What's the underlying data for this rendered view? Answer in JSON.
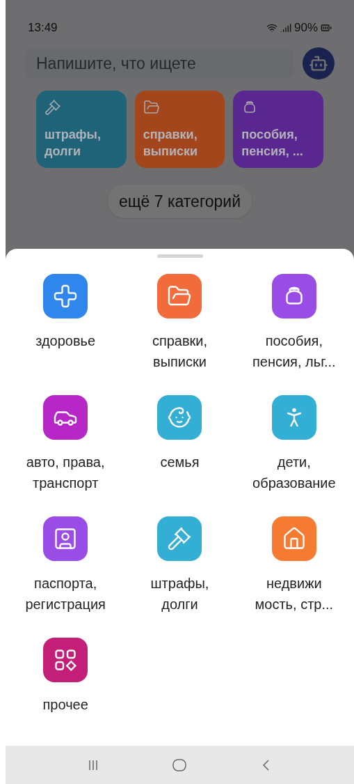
{
  "status_bar": {
    "time": "13:49",
    "battery": "90%"
  },
  "search": {
    "placeholder": "Напишите, что ищете"
  },
  "quick_tiles": [
    {
      "label": "штрафы,\nдолги",
      "kind": "fines",
      "color": "#1f6378"
    },
    {
      "label": "справки,\nвыписки",
      "kind": "documents",
      "color": "#a4461c"
    },
    {
      "label": "пособия,\nпенсия, ...",
      "kind": "benefits",
      "color": "#59278f"
    }
  ],
  "more_button": {
    "label": "ещё 7 категорий"
  },
  "categories": [
    {
      "label": "здоровье",
      "kind": "health",
      "color": "#2f86ec"
    },
    {
      "label": "справки,\nвыписки",
      "kind": "documents",
      "color": "#f26b3a"
    },
    {
      "label": "пособия,\nпенсия, льг...",
      "kind": "benefits",
      "color": "#9a4de6"
    },
    {
      "label": "авто, права,\nтранспорт",
      "kind": "auto",
      "color": "#b726c7"
    },
    {
      "label": "семья",
      "kind": "family",
      "color": "#33aed4"
    },
    {
      "label": "дети,\nобразование",
      "kind": "children",
      "color": "#33aed4"
    },
    {
      "label": "паспорта,\nрегистрация",
      "kind": "passport",
      "color": "#9a4de6"
    },
    {
      "label": "штрафы,\nдолги",
      "kind": "fines",
      "color": "#33aed4"
    },
    {
      "label": "недвижи\nмость, стр...",
      "kind": "realty",
      "color": "#f57a32"
    },
    {
      "label": "прочее",
      "kind": "other",
      "color": "#c41f78"
    }
  ]
}
